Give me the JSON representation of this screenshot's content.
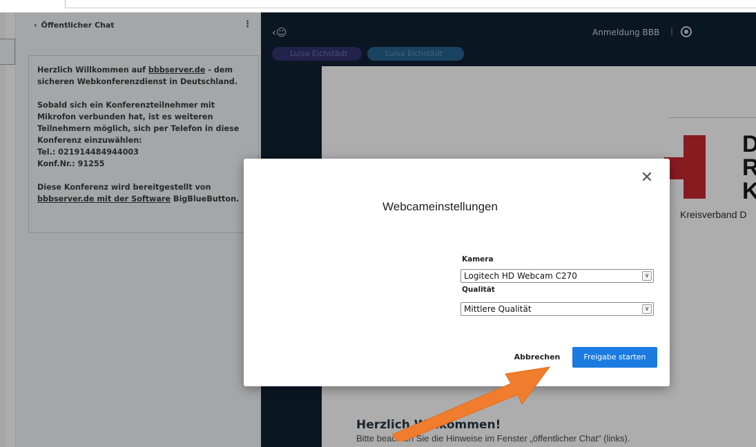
{
  "chat": {
    "header_title": "Öffentlicher Chat",
    "welcome_line1_a": "Herzlich Willkommen auf ",
    "welcome_line1_link": "bbbserver.de",
    "welcome_line1_b": " - dem sicheren Webkonferenzdienst in Deutschland.",
    "paragraph2": "Sobald sich ein Konferenzteilnehmer mit Mikrofon verbunden hat, ist es weiteren Teilnehmern möglich, sich per Telefon in diese Konferenz einzuwählen:",
    "phone": "Tel.: 021914484944003",
    "conf_nr": "Konf.Nr.: 91255",
    "provided_a": "Diese Konferenz wird bereitgestellt von ",
    "provided_link": "bbbserver.de mit der Software",
    "provided_b": " BigBlueButton."
  },
  "main": {
    "top_title": "Anmeldung BBB",
    "separator": "|",
    "participants": [
      "Luisa Eichstädt",
      "Luisa Eichstädt"
    ],
    "slide_letters": "D\nR\nK",
    "slide_subtitle": "Kreisverband D",
    "welcome_title": "Herzlich Willkommen!",
    "welcome_text": "Bitte beachten Sie die Hinweise im Fenster „öffentlicher Chat“ (links)."
  },
  "modal": {
    "title": "Webcameinstellungen",
    "camera_label": "Kamera",
    "camera_value": "Logitech HD Webcam C270",
    "quality_label": "Qualität",
    "quality_value": "Mittlere Qualität",
    "cancel_label": "Abbrechen",
    "start_label": "Freigabe starten"
  },
  "colors": {
    "dark_bg": "#06172a",
    "primary_button": "#1b7be1",
    "annotation_arrow": "#ef7d2d",
    "red_cross": "#c62027"
  }
}
